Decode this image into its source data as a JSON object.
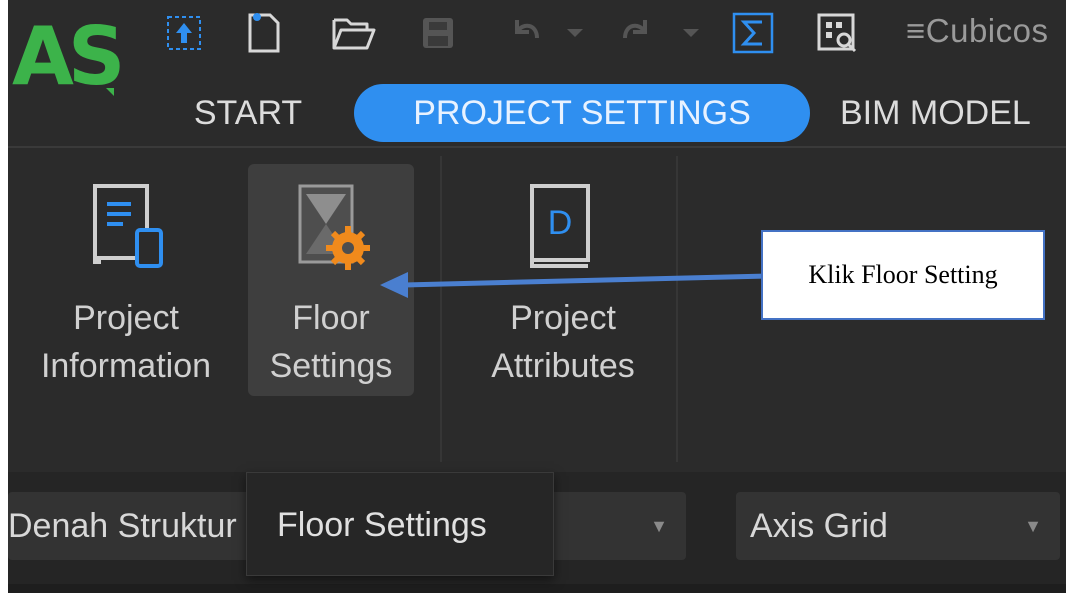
{
  "app": {
    "logo_text": "AS",
    "quick_access_overflow": "Cubicos"
  },
  "tabs": [
    {
      "label": "START",
      "active": false
    },
    {
      "label": "PROJECT SETTINGS",
      "active": true
    },
    {
      "label": "BIM MODEL",
      "active": false
    }
  ],
  "ribbon": {
    "project_information": "Project\nInformation",
    "floor_settings": "Floor\nSettings",
    "project_attributes": "Project\nAttributes",
    "attributes_icon_letter": "D"
  },
  "lower_bar": {
    "floor_combo_value": "Denah Struktur",
    "grid_combo_value": "Axis Grid"
  },
  "tooltip": {
    "text": "Floor Settings"
  },
  "annotation": {
    "text": "Klik Floor Setting"
  },
  "colors": {
    "accent": "#2f8ff0",
    "logo_green": "#3cb34a",
    "icon_blue": "#2f8ff0",
    "icon_orange": "#f08a1c",
    "callout_border": "#4472c4",
    "arrow": "#4a7fd0"
  },
  "icons": [
    "upload-icon",
    "new-file-icon",
    "open-folder-icon",
    "save-icon",
    "undo-icon",
    "redo-icon",
    "sum-icon",
    "grid-search-icon"
  ]
}
